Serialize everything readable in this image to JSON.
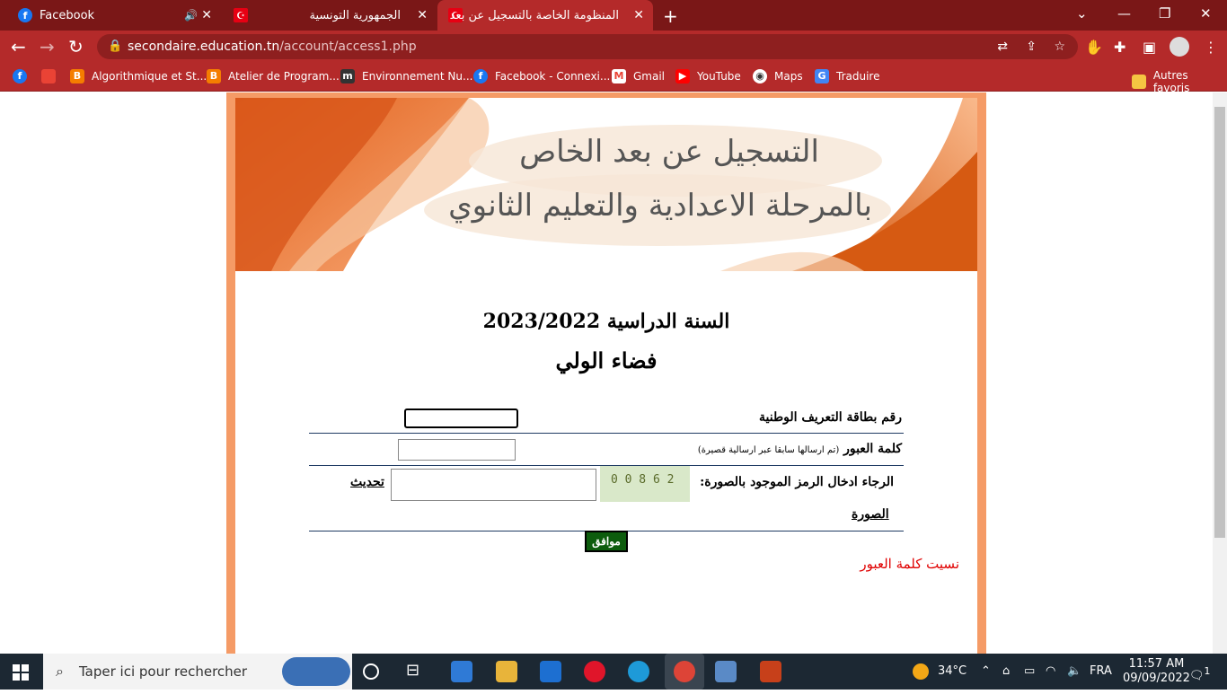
{
  "tabs": [
    {
      "title": "Facebook",
      "favicon": "facebook-icon",
      "audio": "speaker-icon"
    },
    {
      "title": "الجمهورية التونسية",
      "favicon": "tunisia-flag-icon"
    },
    {
      "title": "المنظومة الخاصة بالتسجيل عن بعد",
      "favicon": "tunisia-flag-icon",
      "active": true
    }
  ],
  "address": {
    "host": "secondaire.education.tn",
    "path": "/account/access1.php"
  },
  "bookmarks": [
    {
      "label": "Algorithmique et St...",
      "icon": "blogger-icon",
      "color": "#f57d00"
    },
    {
      "label": "Atelier de Program...",
      "icon": "blogger-icon",
      "color": "#f57d00"
    },
    {
      "label": "Environnement Nu...",
      "icon": "moodle-icon",
      "color": "#333333"
    },
    {
      "label": "Facebook - Connexi...",
      "icon": "facebook-icon",
      "color": "#1877f2"
    },
    {
      "label": "Gmail",
      "icon": "gmail-icon",
      "color": "#ea4335"
    },
    {
      "label": "YouTube",
      "icon": "youtube-icon",
      "color": "#ff0000"
    },
    {
      "label": "Maps",
      "icon": "globe-icon",
      "color": "#ffffff"
    },
    {
      "label": "Traduire",
      "icon": "translate-icon",
      "color": "#4285f4"
    }
  ],
  "other_bookmarks": "Autres favoris",
  "banner": {
    "line1": "التسجيل عن بعد الخاص",
    "line2": "بالمرحلة الاعدادية والتعليم الثانوي"
  },
  "year_title": "السنة الدراسية 2023/2022",
  "space_title": "فضاء الولي",
  "form": {
    "cin_label": "رقم بطاقة التعريف الوطنية",
    "password_label": "كلمة العبور",
    "password_hint": "(تم ارسالها سابقا عبر ارسالية قصيرة)",
    "captcha_label": "الرجاء ادخال الرمز الموجود بالصورة:",
    "captcha_text": "0 0 8 6 2",
    "refresh_line1": "تحديث",
    "refresh_line2": "الصورة",
    "submit_label": "موافق",
    "forgot_label": "نسيت كلمة العبور"
  },
  "taskbar": {
    "search_placeholder": "Taper ici pour rechercher",
    "weather": "34°C",
    "lang": "FRA",
    "time": "11:57 AM",
    "date": "09/09/2022",
    "notif_count": "1"
  },
  "colors": {
    "chrome_dark": "#7a1717",
    "chrome": "#b42a2a",
    "frame": "#f59b66",
    "submit": "#0d5c0d",
    "forgot": "#e00000"
  }
}
